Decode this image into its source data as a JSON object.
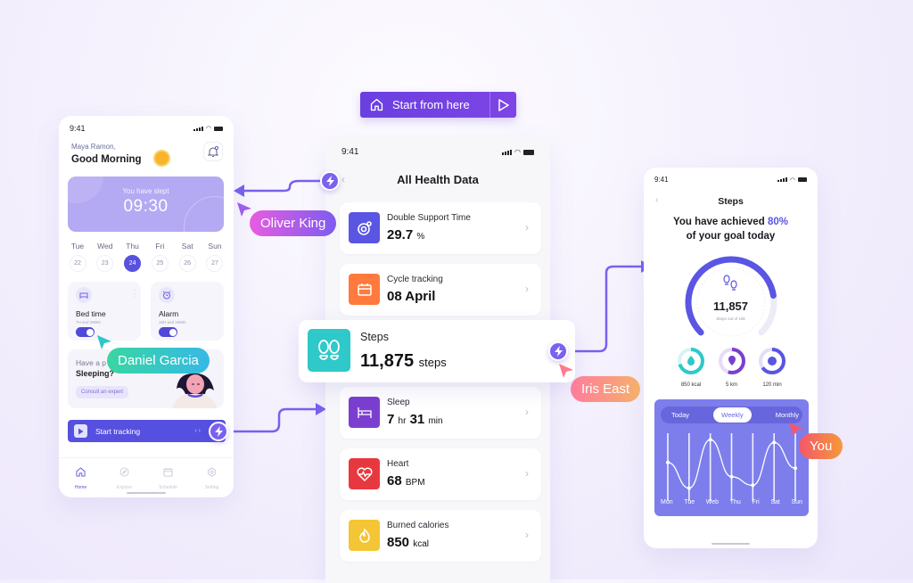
{
  "start_button": {
    "label": "Start from here",
    "home_icon": "home-icon",
    "play_icon": "play-icon"
  },
  "collaborators": [
    {
      "name": "Oliver King",
      "color_from": "#e85ce0",
      "color_to": "#7c5cf0"
    },
    {
      "name": "Daniel Garcia",
      "color_from": "#39d6a2",
      "color_to": "#35b9e6"
    },
    {
      "name": "Iris East",
      "color_from": "#ff7c9c",
      "color_to": "#f5b16a"
    },
    {
      "name": "You",
      "color_from": "#f4566c",
      "color_to": "#f59a3a"
    }
  ],
  "home_screen": {
    "status_time": "9:41",
    "user_name": "Maya Ramon,",
    "greeting": "Good Morning",
    "slept_label": "You have slept",
    "slept_value": "09:30",
    "days": [
      {
        "name": "Tue",
        "date": "22",
        "active": false
      },
      {
        "name": "Wed",
        "date": "23",
        "active": false
      },
      {
        "name": "Thu",
        "date": "24",
        "active": true
      },
      {
        "name": "Fri",
        "date": "25",
        "active": false
      },
      {
        "name": "Sat",
        "date": "26",
        "active": false
      },
      {
        "name": "Sun",
        "date": "27",
        "active": false
      }
    ],
    "bed_time": {
      "title": "Bed time",
      "subtitle": "7H and 28Min",
      "enabled": true
    },
    "alarm": {
      "title": "Alarm",
      "subtitle": "16H and 18Min",
      "enabled": true
    },
    "consult": {
      "line1": "Have a p",
      "line2": "Sleeping?",
      "button": "Consult an expert"
    },
    "start_tracking": "Start tracking",
    "tabs": [
      {
        "label": "Home",
        "icon": "home-icon",
        "active": true
      },
      {
        "label": "Explore",
        "icon": "compass-icon",
        "active": false
      },
      {
        "label": "Schedule",
        "icon": "calendar-icon",
        "active": false
      },
      {
        "label": "Setting",
        "icon": "gear-icon",
        "active": false
      }
    ]
  },
  "health_screen": {
    "status_time": "9:41",
    "title": "All Health Data",
    "items": [
      {
        "title": "Double Support Time",
        "value": "29.7",
        "unit": "%",
        "color": "#5a55e3",
        "icon": "target-icon"
      },
      {
        "title": "Cycle tracking",
        "value": "08 April",
        "unit": "",
        "color": "#ff7a3c",
        "icon": "calendar-icon"
      },
      {
        "title": "Sleep",
        "value_parts": [
          "7",
          "hr",
          "31",
          "min"
        ],
        "color": "#7b3fd0",
        "icon": "bed-icon"
      },
      {
        "title": "Heart",
        "value": "68",
        "unit": "BPM",
        "color": "#e8383f",
        "icon": "heart-pulse-icon"
      },
      {
        "title": "Burned calories",
        "value": "850",
        "unit": "kcal",
        "color": "#f4c534",
        "icon": "flame-icon"
      }
    ],
    "steps_card": {
      "title": "Steps",
      "value": "11,875",
      "unit": "steps",
      "color": "#2ec9c8",
      "icon": "footprints-icon"
    }
  },
  "steps_screen": {
    "status_time": "9:41",
    "title": "Steps",
    "achieved_prefix": "You have achieved",
    "achieved_percent": "80%",
    "achieved_suffix": "of your goal today",
    "goal_fraction": 0.8,
    "steps_value": "11,857",
    "steps_sub": "Steps out of 18k",
    "rings": [
      {
        "label": "850 kcal",
        "fraction": 0.7,
        "color": "#2ec9c8",
        "track": "#d5f4f3",
        "icon": "flame-icon"
      },
      {
        "label": "5 km",
        "fraction": 0.55,
        "color": "#7b3fd0",
        "track": "#e7dcf8",
        "icon": "location-pin-icon"
      },
      {
        "label": "120 min",
        "fraction": 0.65,
        "color": "#5a55e3",
        "track": "#e0dffa",
        "icon": "timer-icon"
      }
    ],
    "segments": [
      {
        "label": "Today",
        "active": false
      },
      {
        "label": "Weekly",
        "active": true
      },
      {
        "label": "Monthly",
        "active": false
      }
    ],
    "chart_data": {
      "type": "line",
      "categories": [
        "Mon",
        "Tue",
        "Web",
        "Thu",
        "Fri",
        "Sat",
        "Sun"
      ],
      "values": [
        0.55,
        0.1,
        0.95,
        0.3,
        0.15,
        0.9,
        0.45
      ]
    }
  }
}
